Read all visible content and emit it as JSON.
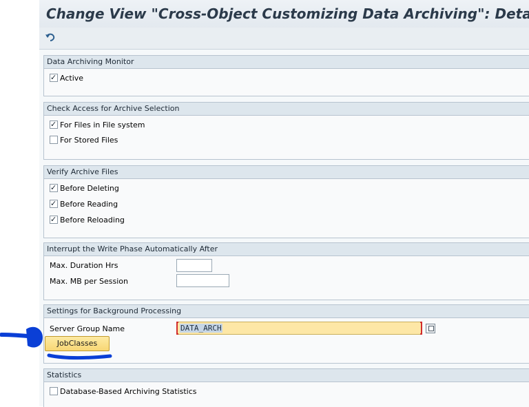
{
  "title": "Change View \"Cross-Object Customizing Data Archiving\": Details",
  "toolbar": {
    "undo_icon": "undo-arrow-icon"
  },
  "sections": {
    "monitor": {
      "header": "Data Archiving Monitor",
      "items": [
        {
          "label": "Active",
          "checked": true
        }
      ]
    },
    "access": {
      "header": "Check Access for Archive Selection",
      "items": [
        {
          "label": "For Files in File system",
          "checked": true
        },
        {
          "label": "For Stored Files",
          "checked": false
        }
      ]
    },
    "verify": {
      "header": "Verify Archive Files",
      "items": [
        {
          "label": "Before Deleting",
          "checked": true
        },
        {
          "label": "Before Reading",
          "checked": true
        },
        {
          "label": "Before Reloading",
          "checked": true
        }
      ]
    },
    "interrupt": {
      "header": "Interrupt the Write Phase Automatically After",
      "max_hrs_label": "Max. Duration Hrs",
      "max_hrs_value": "",
      "max_mb_label": "Max. MB per Session",
      "max_mb_value": ""
    },
    "background": {
      "header": "Settings for Background Processing",
      "server_group_label": "Server Group Name",
      "server_group_value": "DATA_ARCH",
      "jobclasses_label": "JobClasses"
    },
    "statistics": {
      "header": "Statistics",
      "items": [
        {
          "label": "Database-Based Archiving Statistics",
          "checked": false
        }
      ]
    }
  },
  "colors": {
    "annotation": "#0a3fd6",
    "required_field": "#fde7a6",
    "button": "#f8d774"
  }
}
